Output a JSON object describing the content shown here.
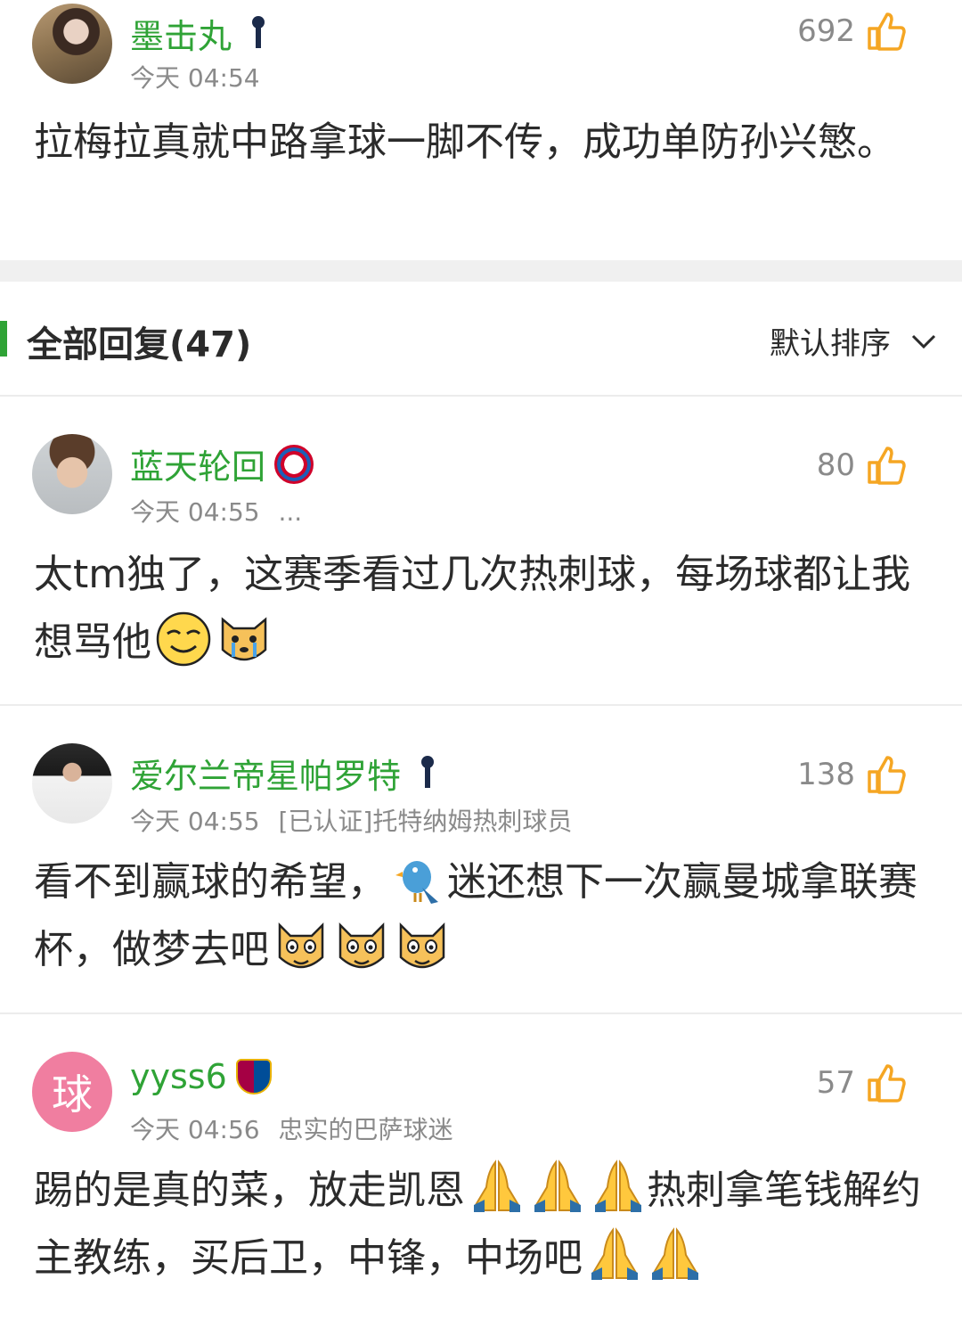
{
  "top_comment": {
    "username": "墨击丸",
    "badge": "spurs-badge",
    "time": "今天 04:54",
    "likes": "692",
    "content": "拉梅拉真就中路拿球一脚不传，成功单防孙兴慜。"
  },
  "replies_header": {
    "title": "全部回复(47)",
    "sort_label": "默认排序"
  },
  "replies": [
    {
      "username": "蓝天轮回",
      "badge": "bayern-badge",
      "time": "今天 04:55",
      "extra": "...",
      "likes": "80",
      "content": "太tm独了，这赛季看过几次热刺球，每场球都让我想骂他"
    },
    {
      "username": "爱尔兰帝星帕罗特",
      "badge": "spurs-badge",
      "time": "今天 04:55",
      "extra": "[已认证]托特纳姆热刺球员",
      "likes": "138",
      "content_a": "看不到赢球的希望，",
      "content_b": "迷还想下一次赢曼城拿联赛杯，做梦去吧"
    },
    {
      "username": "yyss6",
      "avatar_letter": "球",
      "badge": "barcelona-badge",
      "time": "今天 04:56",
      "extra": "忠实的巴萨球迷",
      "likes": "57",
      "content_a": "踢的是真的菜，放走凯恩",
      "content_b": "热刺拿笔钱解约主教练，买后卫，中锋，中场吧"
    }
  ],
  "colors": {
    "username_green": "#2fa336",
    "like_orange": "#f5a623",
    "meta_gray": "#8a8a8a"
  }
}
